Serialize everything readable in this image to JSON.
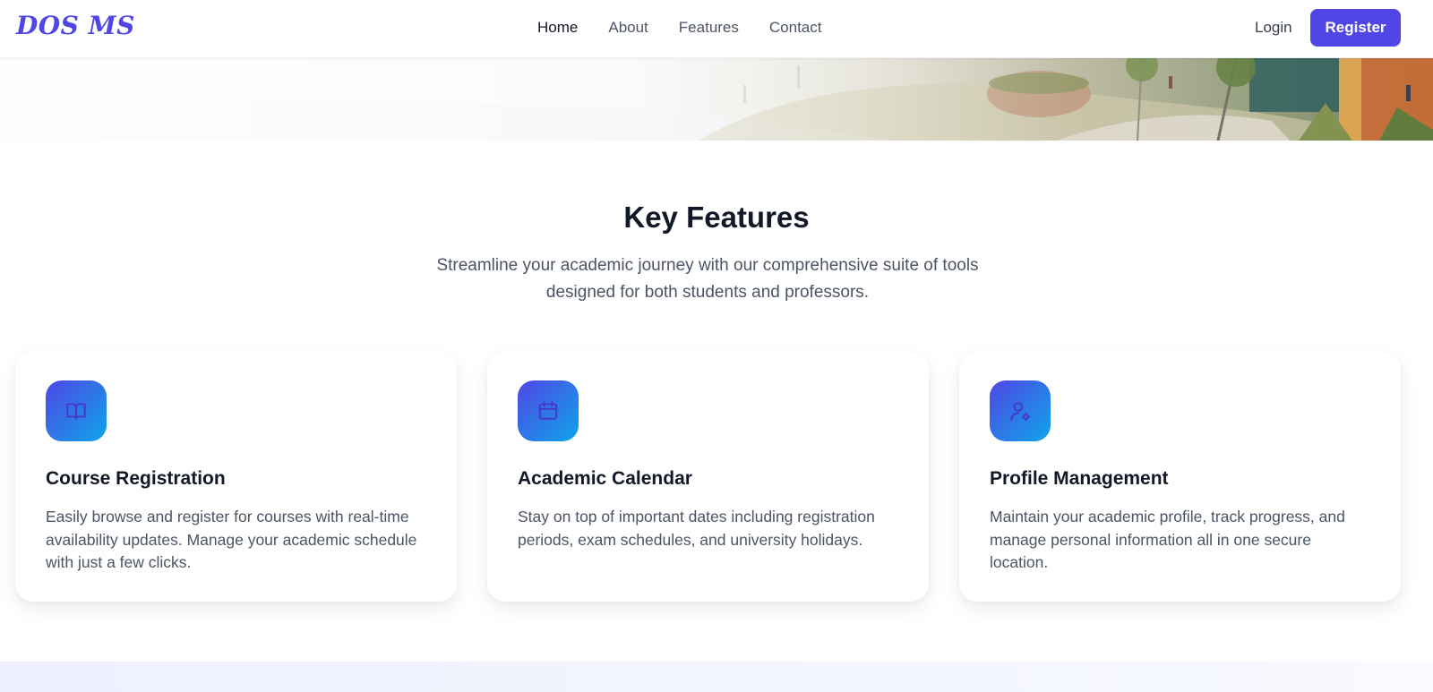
{
  "brand": {
    "logo_text": "DOS MS",
    "accent": "#4f46e5"
  },
  "nav": {
    "links": [
      {
        "label": "Home",
        "active": true
      },
      {
        "label": "About"
      },
      {
        "label": "Features"
      },
      {
        "label": "Contact"
      }
    ],
    "login_label": "Login",
    "register_label": "Register"
  },
  "features": {
    "title": "Key Features",
    "subtitle": "Streamline your academic journey with our comprehensive suite of tools designed for both students and professors.",
    "cards": [
      {
        "icon": "book-open-icon",
        "title": "Course Registration",
        "text": "Easily browse and register for courses with real-time availability updates. Manage your academic schedule with just a few clicks."
      },
      {
        "icon": "calendar-icon",
        "title": "Academic Calendar",
        "text": "Stay on top of important dates including registration periods, exam schedules, and university holidays."
      },
      {
        "icon": "user-cog-icon",
        "title": "Profile Management",
        "text": "Maintain your academic profile, track progress, and manage personal information all in one secure location."
      }
    ]
  }
}
